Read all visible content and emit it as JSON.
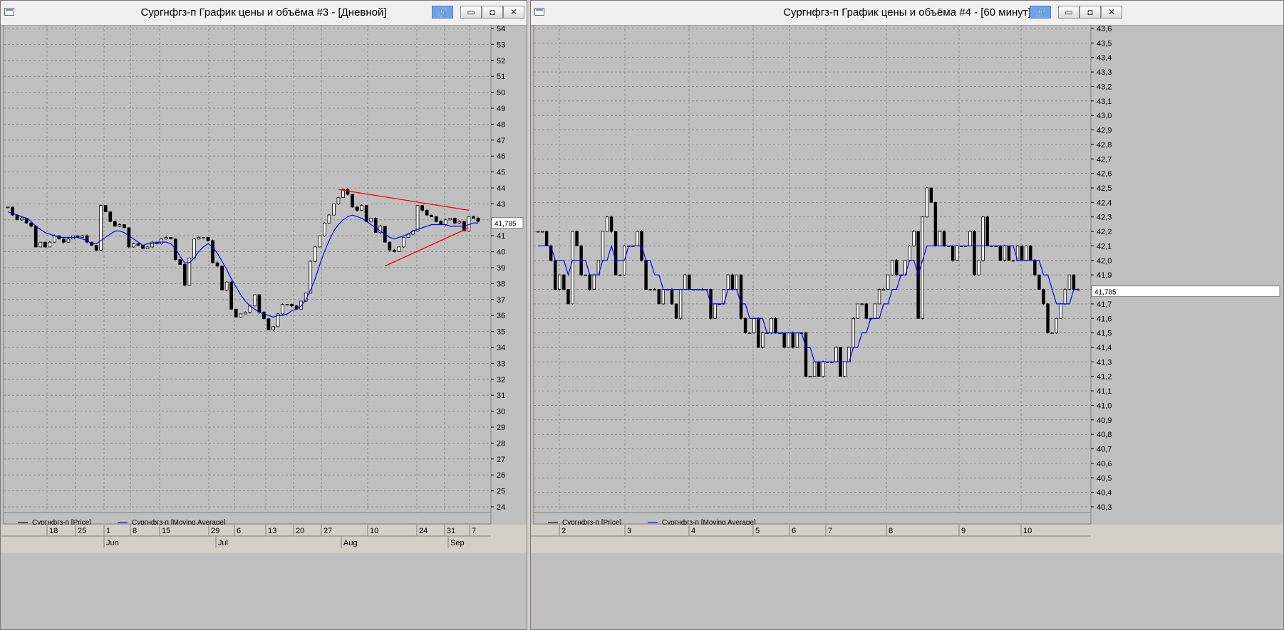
{
  "windows": [
    {
      "title": "Сургнфгз-п График цены и объёма #3 - [Дневной]",
      "legend": [
        {
          "label": "Сургнфгз-п [Price]",
          "color": "#000000"
        },
        {
          "label": "Сургнфгз-п [Moving Average]",
          "color": "#0000ff"
        }
      ],
      "last_value": "41,785",
      "date_ticks": [
        "18",
        "25",
        "1",
        "8",
        "15",
        "29",
        "6",
        "13",
        "20",
        "27",
        "10",
        "24",
        "31",
        "7"
      ],
      "month_labels": [
        "Jun",
        "Jul",
        "Aug",
        "Sep"
      ],
      "y_ticks": [
        "54",
        "53",
        "52",
        "51",
        "50",
        "49",
        "48",
        "47",
        "46",
        "45",
        "44",
        "43",
        "42",
        "41",
        "40",
        "39",
        "38",
        "37",
        "36",
        "35",
        "34",
        "33",
        "32",
        "31",
        "30",
        "29",
        "28",
        "27",
        "26",
        "25",
        "24"
      ]
    },
    {
      "title": "Сургнфгз-п График цены и объёма #4 - [60 минут]",
      "legend": [
        {
          "label": "Сургнфгз-п [Price]",
          "color": "#000000"
        },
        {
          "label": "Сургнфгз-п [Moving Average]",
          "color": "#0000ff"
        }
      ],
      "last_value": "41,785",
      "date_ticks": [
        "2",
        "3",
        "4",
        "5",
        "6",
        "7",
        "8",
        "9",
        "10"
      ],
      "month_labels": [],
      "y_ticks": [
        "43,6",
        "43,5",
        "43,4",
        "43,3",
        "43,2",
        "43,1",
        "43,0",
        "42,9",
        "42,8",
        "42,7",
        "42,6",
        "42,5",
        "42,4",
        "42,3",
        "42,2",
        "42,1",
        "42,0",
        "41,9",
        "41,8",
        "41,7",
        "41,6",
        "41,5",
        "41,4",
        "41,3",
        "41,2",
        "41,1",
        "41,0",
        "40,9",
        "40,8",
        "40,7",
        "40,6",
        "40,5",
        "40,4",
        "40,3"
      ]
    }
  ],
  "colors": {
    "background": "#c0c0c0",
    "grid": "#808080",
    "candle": "#000000",
    "ma_line": "#0000ff",
    "trendline": "#ff0000"
  },
  "chart_data": [
    {
      "type": "candlestick",
      "title": "Сургнфгз-п График цены и объёма #3 - [Дневной]",
      "ylim": [
        24,
        54
      ],
      "grid": true,
      "legend_position": "bottom-left",
      "series": [
        {
          "name": "Сургнфгз-п [Price]",
          "close": [
            42.8,
            42.3,
            42.0,
            42.1,
            41.8,
            41.6,
            40.3,
            40.6,
            40.3,
            40.6,
            41.0,
            40.8,
            40.6,
            40.8,
            41.0,
            40.9,
            41.0,
            40.6,
            40.4,
            40.1,
            42.9,
            42.5,
            41.9,
            41.6,
            41.7,
            41.5,
            40.3,
            40.5,
            40.4,
            40.2,
            40.3,
            40.6,
            40.5,
            40.8,
            40.9,
            40.8,
            39.5,
            39.2,
            37.9,
            39.6,
            40.8,
            40.9,
            40.9,
            40.7,
            39.3,
            39.1,
            37.6,
            38.1,
            36.4,
            35.9,
            36.1,
            36.2,
            36.6,
            37.3,
            36.2,
            35.8,
            35.1,
            35.3,
            36.1,
            36.7,
            36.7,
            36.6,
            36.4,
            36.9,
            37.4,
            39.4,
            40.3,
            41.0,
            41.8,
            42.3,
            43.0,
            43.4,
            43.9,
            43.6,
            42.8,
            42.6,
            42.9,
            41.9,
            42.1,
            41.2,
            41.6,
            40.6,
            40.1,
            40.0,
            40.3,
            40.9,
            41.1,
            41.3,
            42.9,
            42.6,
            42.3,
            42.2,
            41.9,
            41.7,
            42.0,
            42.1,
            41.8,
            41.9,
            41.3,
            42.2,
            42.1,
            41.9
          ]
        },
        {
          "name": "Сургнфгз-п [Moving Average]",
          "values": [
            42.5,
            42.4,
            42.3,
            42.2,
            42.1,
            41.9,
            41.6,
            41.4,
            41.2,
            41.1,
            41.0,
            40.9,
            40.9,
            40.9,
            40.9,
            40.9,
            40.8,
            40.7,
            40.5,
            40.5,
            40.7,
            40.9,
            41.1,
            41.3,
            41.3,
            41.2,
            41.0,
            40.8,
            40.6,
            40.4,
            40.5,
            40.5,
            40.6,
            40.6,
            40.6,
            40.5,
            40.2,
            39.7,
            39.3,
            39.3,
            39.6,
            40.0,
            40.3,
            40.5,
            40.3,
            39.9,
            39.4,
            38.9,
            38.3,
            37.8,
            37.3,
            36.9,
            36.6,
            36.4,
            36.2,
            36.1,
            36.0,
            35.9,
            36.0,
            36.0,
            36.1,
            36.3,
            36.4,
            36.6,
            37.0,
            37.6,
            38.3,
            39.2,
            40.0,
            40.7,
            41.3,
            41.7,
            42.0,
            42.2,
            42.3,
            42.2,
            42.1,
            41.9,
            41.7,
            41.5,
            41.3,
            41.1,
            40.9,
            40.8,
            40.9,
            41.0,
            41.1,
            41.3,
            41.4,
            41.5,
            41.6,
            41.7,
            41.7,
            41.7,
            41.7,
            41.6,
            41.6,
            41.6,
            41.6,
            41.7,
            41.8,
            41.8
          ]
        }
      ],
      "trendlines": [
        {
          "from": {
            "index": 71,
            "value": 43.9
          },
          "to": {
            "index": 99,
            "value": 42.6
          }
        },
        {
          "from": {
            "index": 81,
            "value": 39.1
          },
          "to": {
            "index": 99,
            "value": 41.5
          }
        }
      ]
    },
    {
      "type": "candlestick",
      "title": "Сургнфгз-п График цены и объёма #4 - [60 минут]",
      "ylim": [
        40.3,
        43.6
      ],
      "grid": true,
      "legend_position": "bottom-left",
      "series": [
        {
          "name": "Сургнфгз-п [Price]",
          "close": [
            42.2,
            42.2,
            42.1,
            42.0,
            41.8,
            41.9,
            41.8,
            41.7,
            42.2,
            42.1,
            41.9,
            41.9,
            41.8,
            41.9,
            42.0,
            42.2,
            42.3,
            42.2,
            41.9,
            41.9,
            42.1,
            42.1,
            42.1,
            42.2,
            42.0,
            41.8,
            41.8,
            41.8,
            41.7,
            41.8,
            41.8,
            41.7,
            41.6,
            41.8,
            41.9,
            41.8,
            41.8,
            41.8,
            41.8,
            41.8,
            41.6,
            41.7,
            41.7,
            41.8,
            41.9,
            41.8,
            41.9,
            41.6,
            41.5,
            41.5,
            41.6,
            41.4,
            41.5,
            41.5,
            41.6,
            41.5,
            41.5,
            41.4,
            41.5,
            41.4,
            41.5,
            41.5,
            41.2,
            41.2,
            41.3,
            41.2,
            41.3,
            41.3,
            41.3,
            41.4,
            41.2,
            41.3,
            41.4,
            41.6,
            41.7,
            41.7,
            41.6,
            41.6,
            41.7,
            41.8,
            41.8,
            41.9,
            42.0,
            41.9,
            41.9,
            42.0,
            42.1,
            42.2,
            41.6,
            42.3,
            42.5,
            42.4,
            42.1,
            42.2,
            42.1,
            42.1,
            42.0,
            42.1,
            42.1,
            42.1,
            42.2,
            41.9,
            42.0,
            42.3,
            42.1,
            42.1,
            42.1,
            42.0,
            42.1,
            42.0,
            42.0,
            42.1,
            42.0,
            42.1,
            42.0,
            41.9,
            41.8,
            41.7,
            41.5,
            41.5,
            41.6,
            41.7,
            41.8,
            41.9,
            41.8,
            41.8
          ]
        },
        {
          "name": "Сургнфгз-п [Moving Average]",
          "values": [
            42.1,
            42.1,
            42.1,
            42.1,
            42.0,
            42.0,
            42.0,
            41.9,
            42.0,
            42.0,
            42.0,
            42.0,
            41.9,
            41.9,
            41.9,
            42.0,
            42.0,
            42.1,
            42.0,
            42.0,
            42.0,
            42.1,
            42.1,
            42.1,
            42.1,
            42.0,
            42.0,
            41.9,
            41.9,
            41.8,
            41.8,
            41.8,
            41.8,
            41.8,
            41.8,
            41.8,
            41.8,
            41.8,
            41.8,
            41.8,
            41.7,
            41.7,
            41.7,
            41.7,
            41.8,
            41.8,
            41.8,
            41.7,
            41.7,
            41.6,
            41.6,
            41.6,
            41.6,
            41.5,
            41.5,
            41.5,
            41.5,
            41.5,
            41.5,
            41.5,
            41.5,
            41.5,
            41.4,
            41.4,
            41.3,
            41.3,
            41.3,
            41.3,
            41.3,
            41.3,
            41.3,
            41.3,
            41.3,
            41.4,
            41.4,
            41.5,
            41.5,
            41.6,
            41.6,
            41.6,
            41.7,
            41.7,
            41.8,
            41.8,
            41.9,
            41.9,
            42.0,
            42.0,
            41.9,
            42.0,
            42.1,
            42.1,
            42.1,
            42.1,
            42.1,
            42.1,
            42.1,
            42.1,
            42.1,
            42.1,
            42.1,
            42.1,
            42.1,
            42.1,
            42.1,
            42.1,
            42.1,
            42.1,
            42.1,
            42.1,
            42.1,
            42.0,
            42.0,
            42.0,
            42.0,
            42.0,
            42.0,
            41.9,
            41.9,
            41.8,
            41.7,
            41.7,
            41.7,
            41.7,
            41.8,
            41.8
          ]
        }
      ]
    }
  ]
}
